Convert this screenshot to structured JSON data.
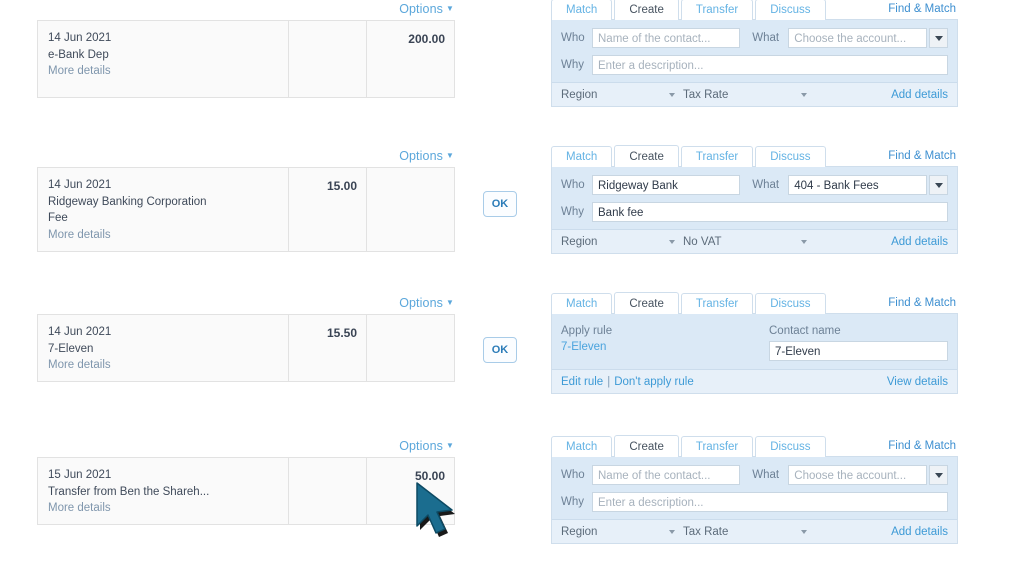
{
  "transactions": [
    {
      "options_label": "Options",
      "date": "14 Jun 2021",
      "description": "e-Bank Dep",
      "extra": "",
      "more_details": "More details",
      "debit": "",
      "credit": "200.00",
      "ok_label": ""
    },
    {
      "options_label": "Options",
      "date": "14 Jun 2021",
      "description": "Ridgeway Banking Corporation",
      "extra": "Fee",
      "more_details": "More details",
      "debit": "15.00",
      "credit": "",
      "ok_label": "OK"
    },
    {
      "options_label": "Options",
      "date": "14 Jun 2021",
      "description": "7-Eleven",
      "extra": "",
      "more_details": "More details",
      "debit": "15.50",
      "credit": "",
      "ok_label": "OK"
    },
    {
      "options_label": "Options",
      "date": "15 Jun 2021",
      "description": "Transfer from Ben the Shareh...",
      "extra": "",
      "more_details": "More details",
      "debit": "",
      "credit": "50.00",
      "ok_label": ""
    }
  ],
  "tabs": [
    "Match",
    "Create",
    "Transfer",
    "Discuss"
  ],
  "find_and_match": "Find & Match",
  "active_tab": "Create",
  "panels": [
    {
      "type": "create",
      "who_label": "Who",
      "who_value": "Name of the contact...",
      "who_filled": false,
      "what_label": "What",
      "what_value": "Choose the account...",
      "what_filled": false,
      "why_label": "Why",
      "why_value": "Enter a description...",
      "why_filled": false,
      "region_label": "Region",
      "tax_label": "Tax Rate",
      "add_details": "Add details"
    },
    {
      "type": "create",
      "who_label": "Who",
      "who_value": "Ridgeway Bank",
      "who_filled": true,
      "what_label": "What",
      "what_value": "404 - Bank Fees",
      "what_filled": true,
      "why_label": "Why",
      "why_value": "Bank fee",
      "why_filled": true,
      "region_label": "Region",
      "tax_label": "No VAT",
      "add_details": "Add details"
    },
    {
      "type": "rule",
      "apply_rule_label": "Apply rule",
      "apply_rule_value": "7-Eleven",
      "contact_name_label": "Contact name",
      "contact_name_value": "7-Eleven",
      "edit_rule": "Edit rule",
      "separator": "|",
      "dont_apply_rule": "Don't apply rule",
      "view_details": "View details"
    },
    {
      "type": "create",
      "who_label": "Who",
      "who_value": "Name of the contact...",
      "who_filled": false,
      "what_label": "What",
      "what_value": "Choose the account...",
      "what_filled": false,
      "why_label": "Why",
      "why_value": "Enter a description...",
      "why_filled": false,
      "region_label": "Region",
      "tax_label": "Tax Rate",
      "add_details": "Add details"
    }
  ],
  "colors": {
    "link": "#3d9ad6",
    "tab_inactive": "#64b3e4",
    "panel_bg": "#dbe9f6",
    "panel_footer_bg": "#e7f0f9",
    "row_bg": "#fafafa",
    "cursor": "#1b6d8f"
  }
}
